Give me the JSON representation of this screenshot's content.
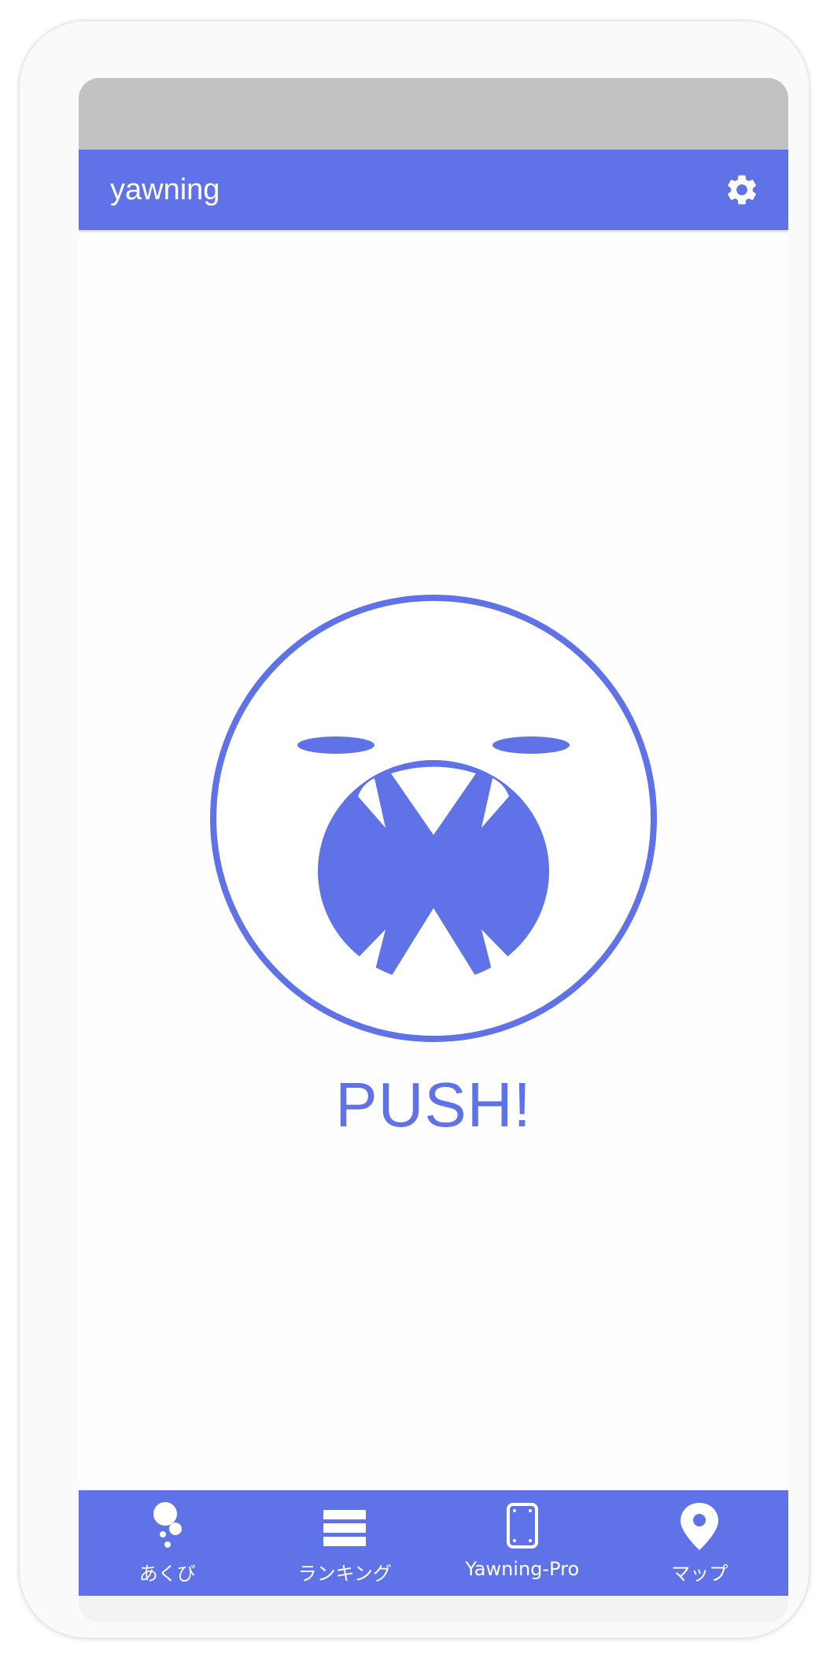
{
  "app_bar": {
    "title": "yawning",
    "settings_icon": "gear-icon"
  },
  "main": {
    "push_label": "PUSH!",
    "yawn_icon": "yawning-face-icon"
  },
  "bottom_nav": {
    "items": [
      {
        "label": "あくび",
        "icon": "bubbles-icon"
      },
      {
        "label": "ランキング",
        "icon": "list-icon"
      },
      {
        "label": "Yawning-Pro",
        "icon": "phone-frame-icon"
      },
      {
        "label": "マップ",
        "icon": "map-pin-icon"
      }
    ]
  },
  "colors": {
    "primary": "#5f72e8",
    "status_bar": "#c2c2c2",
    "background": "#fefefe"
  }
}
